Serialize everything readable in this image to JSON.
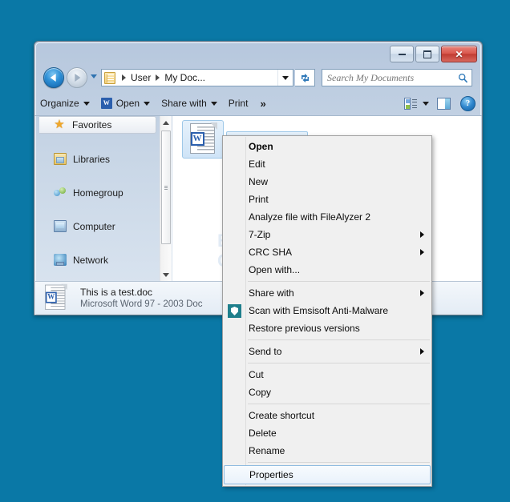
{
  "desktop": {
    "background_color": "#0a78a6"
  },
  "window": {
    "title": "",
    "controls": {
      "minimize": "minimize-button",
      "maximize": "maximize-button",
      "close": "close-button"
    }
  },
  "navigation": {
    "back_tooltip": "Back",
    "forward_tooltip": "Forward",
    "recent_pages": "Recent Pages",
    "breadcrumb": [
      "User",
      "My Doc..."
    ],
    "refresh": "Refresh"
  },
  "search": {
    "placeholder": "Search My Documents",
    "value": ""
  },
  "toolbar": {
    "items": [
      {
        "label": "Organize",
        "has_caret": true,
        "icon": null
      },
      {
        "label": "Open",
        "has_caret": true,
        "icon": "word-icon"
      },
      {
        "label": "Share with",
        "has_caret": true,
        "icon": null
      },
      {
        "label": "Print",
        "has_caret": false,
        "icon": null
      }
    ],
    "overflow_label": "»",
    "views_label": "Change your view",
    "preview_pane_label": "Show the preview pane",
    "help_label": "?"
  },
  "sidebar": {
    "items": [
      {
        "label": "Favorites",
        "icon": "star-icon",
        "selected": true
      },
      {
        "label": "Libraries",
        "icon": "libraries-icon",
        "selected": false
      },
      {
        "label": "Homegroup",
        "icon": "homegroup-icon",
        "selected": false
      },
      {
        "label": "Computer",
        "icon": "computer-icon",
        "selected": false
      },
      {
        "label": "Network",
        "icon": "network-icon",
        "selected": false
      }
    ]
  },
  "file_list": {
    "items": [
      {
        "name": "This is a test.doc",
        "icon": "word-document-icon",
        "selected": true
      }
    ],
    "watermark": "BLEEPING\nCOMPUTER"
  },
  "details_pane": {
    "filename": "This is a test.doc",
    "filetype": "Microsoft Word 97 - 2003 Doc"
  },
  "context_menu": {
    "items": [
      {
        "label": "Open",
        "bold": true,
        "submenu": false,
        "icon": null,
        "highlight": false
      },
      {
        "label": "Edit",
        "bold": false,
        "submenu": false,
        "icon": null,
        "highlight": false
      },
      {
        "label": "New",
        "bold": false,
        "submenu": false,
        "icon": null,
        "highlight": false
      },
      {
        "label": "Print",
        "bold": false,
        "submenu": false,
        "icon": null,
        "highlight": false
      },
      {
        "label": "Analyze file with FileAlyzer 2",
        "bold": false,
        "submenu": false,
        "icon": null,
        "highlight": false
      },
      {
        "label": "7-Zip",
        "bold": false,
        "submenu": true,
        "icon": null,
        "highlight": false
      },
      {
        "label": "CRC SHA",
        "bold": false,
        "submenu": true,
        "icon": null,
        "highlight": false
      },
      {
        "label": "Open with...",
        "bold": false,
        "submenu": false,
        "icon": null,
        "highlight": false
      },
      {
        "separator": true
      },
      {
        "label": "Share with",
        "bold": false,
        "submenu": true,
        "icon": null,
        "highlight": false
      },
      {
        "label": "Scan with Emsisoft Anti-Malware",
        "bold": false,
        "submenu": false,
        "icon": "emsisoft-shield-icon",
        "highlight": false
      },
      {
        "label": "Restore previous versions",
        "bold": false,
        "submenu": false,
        "icon": null,
        "highlight": false
      },
      {
        "separator": true
      },
      {
        "label": "Send to",
        "bold": false,
        "submenu": true,
        "icon": null,
        "highlight": false
      },
      {
        "separator": true
      },
      {
        "label": "Cut",
        "bold": false,
        "submenu": false,
        "icon": null,
        "highlight": false
      },
      {
        "label": "Copy",
        "bold": false,
        "submenu": false,
        "icon": null,
        "highlight": false
      },
      {
        "separator": true
      },
      {
        "label": "Create shortcut",
        "bold": false,
        "submenu": false,
        "icon": null,
        "highlight": false
      },
      {
        "label": "Delete",
        "bold": false,
        "submenu": false,
        "icon": null,
        "highlight": false
      },
      {
        "label": "Rename",
        "bold": false,
        "submenu": false,
        "icon": null,
        "highlight": false
      },
      {
        "separator": true
      },
      {
        "label": "Properties",
        "bold": false,
        "submenu": false,
        "icon": null,
        "highlight": true
      }
    ]
  }
}
